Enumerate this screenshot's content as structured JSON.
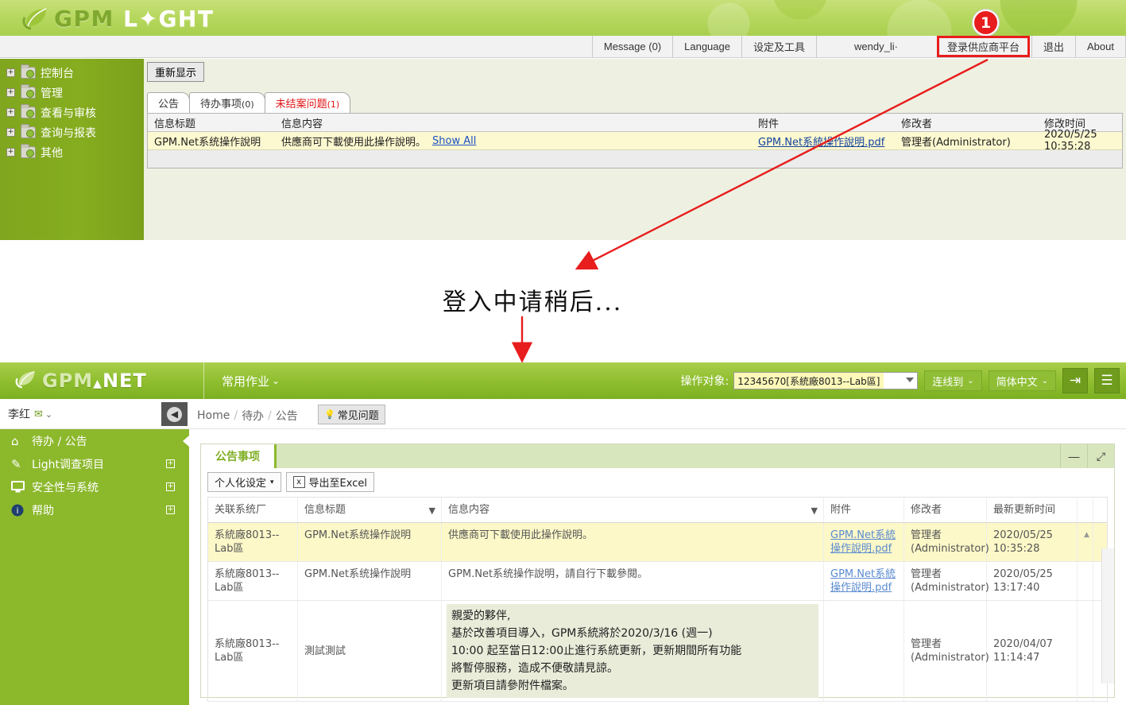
{
  "top_app": {
    "logo": {
      "text_gpm": "GPM",
      "text_light": "L",
      "text_light_rest": "GHT",
      "leaf_icon": "leaf-icon"
    },
    "nav": [
      {
        "label": "Message (0)",
        "name": "message"
      },
      {
        "label": "Language",
        "name": "language"
      },
      {
        "label": "设定及工具",
        "name": "settings-tools"
      },
      {
        "label": "wendy_li·",
        "name": "user"
      },
      {
        "label": "登录供应商平台",
        "name": "supplier-platform-login",
        "highlight": true
      },
      {
        "label": "退出",
        "name": "logout"
      },
      {
        "label": "About",
        "name": "about"
      }
    ],
    "sidebar": [
      {
        "label": "控制台",
        "expand": "+"
      },
      {
        "label": "管理",
        "expand": "+"
      },
      {
        "label": "查看与审核",
        "expand": "+"
      },
      {
        "label": "查询与报表",
        "expand": "+"
      },
      {
        "label": "其他",
        "expand": "+"
      }
    ],
    "refresh_label": "重新显示",
    "tabs": [
      {
        "label": "公告",
        "count": "",
        "active": true,
        "red": false
      },
      {
        "label": "待办事项",
        "count": "(0)",
        "active": false,
        "red": false
      },
      {
        "label": "未结案问题",
        "count": "(1)",
        "active": false,
        "red": true
      }
    ],
    "table": {
      "headers": [
        "信息标题",
        "信息内容",
        "附件",
        "修改者",
        "修改时间"
      ],
      "rows": [
        {
          "title": "GPM.Net系统操作說明",
          "content": "供應商可下載使用此操作說明。",
          "show_all": "Show All",
          "attachment": "GPM.Net系統操作說明.pdf",
          "modifier": "管理者(Administrator)",
          "modified": "2020/5/25 10:35:28"
        }
      ]
    }
  },
  "transition": {
    "text": "登入中请稍后..."
  },
  "annotation": {
    "step_number": "1",
    "highlight_color": "#e81d1d",
    "arrow_color": "#e81d1d"
  },
  "bottom_app": {
    "logo": {
      "text_gpm": "GPM",
      "triangle": "▲",
      "text_net": "NET"
    },
    "menu_label": "常用作业",
    "menu_caret": "⌄",
    "operate_label": "操作对象:",
    "operate_value": "12345670[系統廠8013--Lab區]",
    "buttons": [
      {
        "label": "连线到",
        "caret": "⌄",
        "name": "connect-to"
      },
      {
        "label": "简体中文",
        "caret": "⌄",
        "name": "language-switch"
      }
    ],
    "icon_buttons": [
      {
        "glyph": "⇥",
        "name": "logout-icon"
      },
      {
        "glyph": "☰",
        "name": "menu-icon"
      }
    ],
    "user": {
      "name": "李红",
      "mail_icon": "✉",
      "caret": "⌄"
    },
    "collapse_icon": "◀",
    "breadcrumb": [
      "Home",
      "待办",
      "公告"
    ],
    "faq": {
      "icon": "💡",
      "label": "常见问题"
    },
    "sidebar": [
      {
        "label": "待办 / 公告",
        "icon": "home-icon",
        "glyph": "⌂",
        "expand": "",
        "active": true
      },
      {
        "label": "Light调查项目",
        "icon": "edit-icon",
        "glyph": "✎",
        "expand": "+",
        "active": false
      },
      {
        "label": "安全性与系统",
        "icon": "monitor-icon",
        "glyph": "🖥",
        "expand": "+",
        "active": false
      },
      {
        "label": "帮助",
        "icon": "info-icon",
        "glyph": "i",
        "expand": "+",
        "active": false
      }
    ],
    "panel": {
      "tab_label": "公告事项",
      "tools": [
        {
          "glyph": "—",
          "name": "minimize-icon"
        },
        {
          "glyph": "⤢",
          "name": "expand-icon"
        }
      ],
      "toolbar": [
        {
          "label": "个人化设定",
          "caret": "▾",
          "name": "personalize-button"
        },
        {
          "label": "导出至Excel",
          "icon": "excel-icon",
          "icon_glyph": "x",
          "name": "export-excel-button"
        }
      ],
      "grid": {
        "headers": [
          {
            "label": "关联系统厂",
            "filter": false
          },
          {
            "label": "信息标题",
            "filter": true
          },
          {
            "label": "信息内容",
            "filter": true
          },
          {
            "label": "附件",
            "filter": false
          },
          {
            "label": "修改者",
            "filter": false
          },
          {
            "label": "最新更新时间",
            "filter": false
          }
        ],
        "rows": [
          {
            "selected": true,
            "plant": "系統廠8013--Lab區",
            "title": "GPM.Net系统操作說明",
            "content": "供應商可下載使用此操作說明。",
            "content_lines": [],
            "attachment": "GPM.Net系統操作說明.pdf",
            "modifier": "管理者 (Administrator)",
            "modifier_line1": "管理者",
            "modifier_line2": "(Administrator)",
            "updated_line1": "2020/05/25",
            "updated_line2": "10:35:28"
          },
          {
            "selected": false,
            "plant": "系統廠8013--Lab區",
            "title": "GPM.Net系统操作說明",
            "content": "GPM.Net系统操作說明，請自行下載參閱。",
            "content_lines": [],
            "attachment": "GPM.Net系統操作說明.pdf",
            "modifier": "管理者 (Administrator)",
            "modifier_line1": "管理者",
            "modifier_line2": "(Administrator)",
            "updated_line1": "2020/05/25",
            "updated_line2": "13:17:40"
          },
          {
            "selected": false,
            "plant": "系統廠8013--Lab區",
            "title": "測試測試",
            "content": "",
            "content_lines": [
              "親愛的夥伴,",
              "基於改善項目導入，GPM系統將於2020/3/16 (週一)",
              "10:00 起至當日12:00止進行系統更新，更新期間所有功能",
              "將暫停服務，造成不便敬請見諒。",
              "更新項目請參附件檔案。"
            ],
            "attachment": "",
            "modifier": "管理者 (Administrator)",
            "modifier_line1": "管理者",
            "modifier_line2": "(Administrator)",
            "updated_line1": "2020/04/07",
            "updated_line2": "11:14:47"
          }
        ]
      }
    }
  }
}
